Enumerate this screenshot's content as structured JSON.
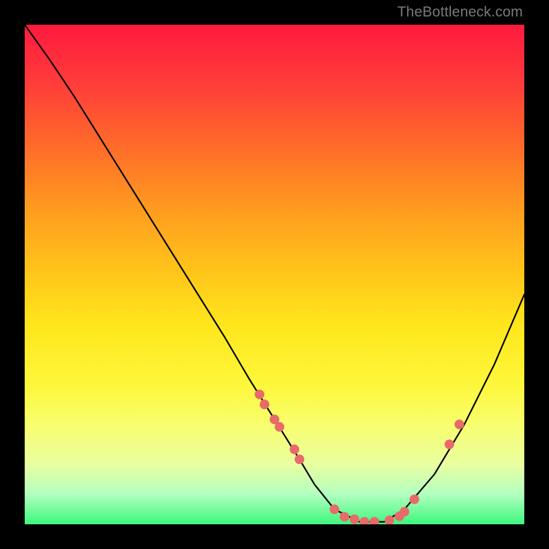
{
  "watermark": {
    "text": "TheBottleneck.com"
  },
  "chart_data": {
    "type": "line",
    "title": "",
    "xlabel": "",
    "ylabel": "",
    "xlim": [
      0,
      100
    ],
    "ylim": [
      0,
      100
    ],
    "grid": false,
    "legend": false,
    "series": [
      {
        "name": "curve",
        "x": [
          0,
          5,
          10,
          15,
          20,
          25,
          30,
          35,
          40,
          45,
          50,
          55,
          58,
          62,
          67,
          72,
          76,
          82,
          88,
          94,
          100
        ],
        "y": [
          100,
          93,
          85.5,
          77.5,
          69.5,
          61.5,
          53.5,
          45.5,
          37.5,
          29,
          21,
          13,
          8,
          3,
          0.5,
          0.5,
          3,
          10,
          20,
          32,
          46
        ]
      }
    ],
    "markers": {
      "name": "points",
      "color": "#e86a6a",
      "x": [
        47,
        48,
        50,
        51,
        54,
        55,
        62,
        64,
        66,
        68,
        70,
        73,
        75,
        76,
        78,
        85,
        87
      ],
      "y": [
        26,
        24,
        21,
        19.5,
        15,
        13,
        3,
        1.5,
        1,
        0.5,
        0.5,
        0.8,
        1.6,
        2.5,
        5,
        16,
        20
      ]
    }
  }
}
